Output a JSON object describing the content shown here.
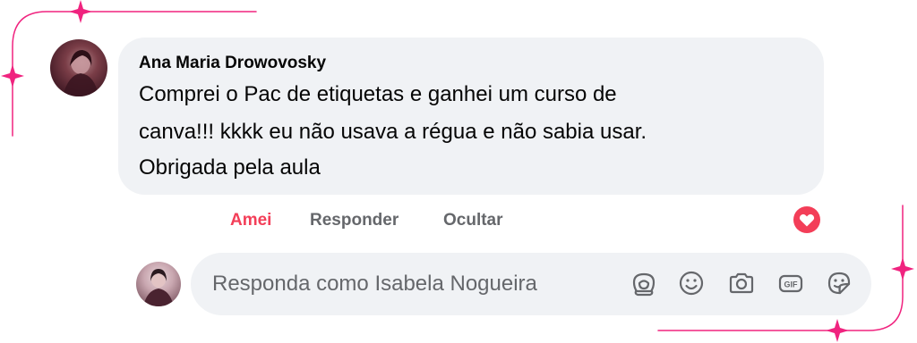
{
  "comment": {
    "author": "Ana Maria Drowovosky",
    "lines": [
      "Comprei o Pac de etiquetas e ganhei um curso de",
      "canva!!! kkkk eu não usava a régua e não sabia usar.",
      "Obrigada pela aula"
    ],
    "reaction": "heart-icon"
  },
  "actions": {
    "love": "Amei",
    "reply": "Responder",
    "hide": "Ocultar"
  },
  "reply_box": {
    "placeholder": "Responda como Isabela Nogueira",
    "tools": [
      "avatar-sticker-icon",
      "emoji-icon",
      "camera-icon",
      "gif-icon",
      "sticker-icon"
    ],
    "gif_label": "GIF"
  },
  "colors": {
    "accent_pink": "#f0237f",
    "love_red": "#f33e58",
    "bubble_bg": "#f0f2f5",
    "muted_text": "#65676b"
  }
}
